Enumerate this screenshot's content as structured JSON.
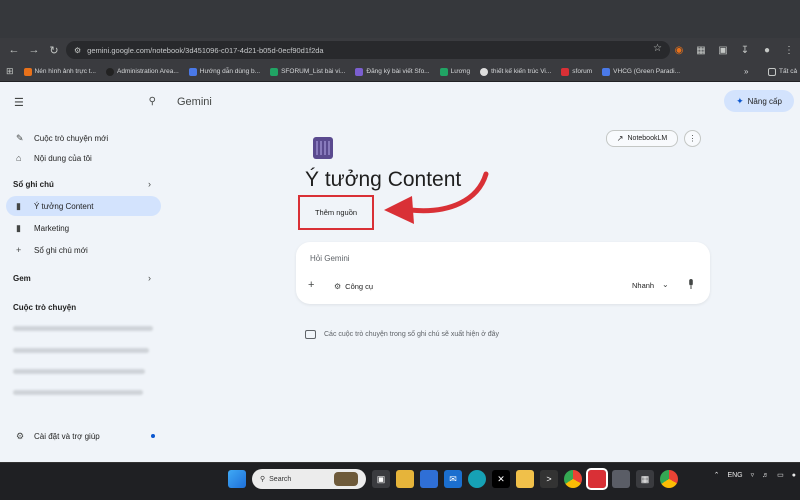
{
  "browser": {
    "url": "gemini.google.com/notebook/3d451096-c017-4d21-b05d-0ecf90d1f2da",
    "bookmarks": [
      {
        "label": "Nén hình ảnh trực t...",
        "color": "#e8711a"
      },
      {
        "label": "Administration Area...",
        "color": "#222222"
      },
      {
        "label": "Hướng dẫn dùng b...",
        "color": "#4a79e8"
      },
      {
        "label": "SFORUM_List bài vi...",
        "color": "#21a464"
      },
      {
        "label": "Đăng ký bài viết Sfo...",
        "color": "#7b5fd0"
      },
      {
        "label": "Lương",
        "color": "#21a464"
      },
      {
        "label": "thiết kế kiến trúc Vi...",
        "color": "#dddddd"
      },
      {
        "label": "sforum",
        "color": "#d93036"
      },
      {
        "label": "VHCG (Green Paradi...",
        "color": "#4a79e8"
      }
    ],
    "bookmarks_more": "»",
    "bookmarks_all": "Tất cả"
  },
  "sidebar": {
    "new_chat": "Cuộc trò chuyện mới",
    "my_content": "Nội dung của tôi",
    "notebooks_header": "Sổ ghi chú",
    "notebook_items": [
      "Ý tưởng Content",
      "Marketing"
    ],
    "new_notebook": "Sổ ghi chú mới",
    "gem_header": "Gem",
    "chats_header": "Cuộc trò chuyện",
    "settings": "Cài đặt và trợ giúp"
  },
  "header": {
    "title": "Gemini",
    "upgrade": "Nâng cấp"
  },
  "notebook": {
    "title": "Ý tưởng Content",
    "add_source": "Thêm nguồn",
    "notebooklm_button": "NotebookLM",
    "more": "⋮"
  },
  "prompt": {
    "placeholder": "Hỏi Gemini",
    "tools": "Công cụ",
    "mode": "Nhanh"
  },
  "empty_note": "Các cuộc trò chuyện trong sổ ghi chú sẽ xuất hiện ở đây",
  "taskbar": {
    "search": "Search",
    "lang": "ENG"
  },
  "colors": {
    "accent": "#d3e3fd",
    "highlight_box": "#d93036"
  }
}
